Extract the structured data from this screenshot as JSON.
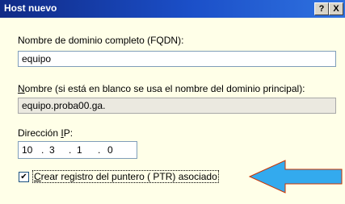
{
  "dialog": {
    "title": "Host nuevo",
    "help_button": "?",
    "close_button": "X"
  },
  "fqdn": {
    "label": "Nombre de dominio completo (FQDN):",
    "value": "equipo"
  },
  "name": {
    "label_ul": "N",
    "label_rest": "ombre (si está en blanco se usa el nombre del dominio principal):",
    "value": "equipo.proba00.ga."
  },
  "ip": {
    "label_pre": "Dirección ",
    "label_ul": "I",
    "label_post": "P:",
    "octets": [
      "10",
      "3",
      "1",
      "0"
    ],
    "separator": "."
  },
  "ptr": {
    "checked": true,
    "check_mark": "✔",
    "label_ul": "C",
    "label_rest": "rear registro del puntero ( PTR) asociado"
  },
  "annotation": {
    "arrow_color": "#33aaee",
    "arrow_outline": "#cc3300"
  }
}
